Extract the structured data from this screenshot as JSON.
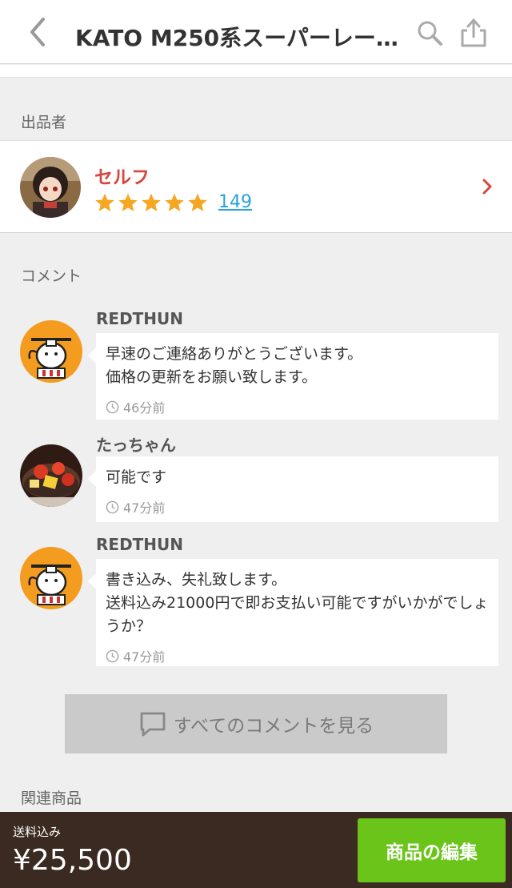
{
  "header": {
    "title": "KATO M250系スーパーレー…"
  },
  "seller": {
    "section_label": "出品者",
    "name": "セルフ",
    "stars": 5,
    "rating_count": "149"
  },
  "comments": {
    "section_label": "コメント",
    "items": [
      {
        "user": "REDTHUN",
        "text": "早速のご連絡ありがとうございます。\n価格の更新をお願い致します。",
        "time": "46分前"
      },
      {
        "user": "たっちゃん",
        "text": "可能です",
        "time": "47分前"
      },
      {
        "user": "REDTHUN",
        "text": "書き込み、失礼致します。\n送料込み21000円で即お支払い可能ですがいかがでしょうか？",
        "time": "47分前"
      }
    ],
    "view_all_label": "すべてのコメントを見る"
  },
  "related": {
    "section_label": "関連商品"
  },
  "bottom_bar": {
    "shipping_label": "送料込み",
    "price": "¥25,500",
    "edit_button_label": "商品の編集"
  },
  "colors": {
    "seller_name": "#d7463f",
    "star": "#f5a623",
    "link": "#2aa3d6",
    "bottom_bar_bg": "#3a2a22",
    "edit_button_bg": "#6ac41a"
  },
  "icons": [
    "back-chevron-icon",
    "search-icon",
    "share-icon",
    "chevron-right-icon",
    "star-icon",
    "clock-icon",
    "comment-bubble-icon"
  ]
}
